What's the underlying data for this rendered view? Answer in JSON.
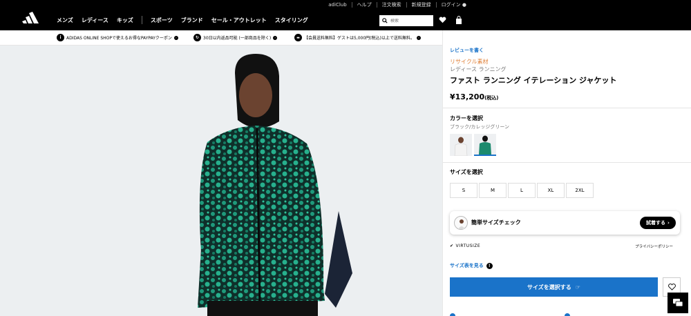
{
  "topbar": {
    "links": [
      "adiClub",
      "ヘルプ",
      "注文検索",
      "新規登録",
      "ログイン"
    ]
  },
  "nav": {
    "items": [
      "メンズ",
      "レディース",
      "キッズ",
      "スポーツ",
      "ブランド",
      "セール・アウトレット",
      "スタイリング"
    ],
    "search_placeholder": "検索",
    "icons": [
      "adidas-logo",
      "search-icon",
      "heart-icon",
      "bag-icon",
      "user-icon"
    ]
  },
  "promo": {
    "items": [
      {
        "icon": "i",
        "text": "ADIDAS ONLINE SHOPで使えるお得なPAYPAYクーポン"
      },
      {
        "icon": "↻",
        "text": "30日以内返品可能 (一部商品を除く)"
      },
      {
        "icon": "🚚",
        "text": "【会員送料無料】ゲストは5,000円(税込)以上で送料無料。"
      }
    ]
  },
  "product": {
    "review_link": "レビューを書く",
    "tag": "リサイクル素材",
    "category": "レディース ランニング",
    "title": "ファスト ランニング イテレーション ジャケット",
    "price": "¥13,200",
    "price_note": "(税込)",
    "color_label": "カラーを選択",
    "color_name": "ブラック/カレッジグリーン",
    "size_label": "サイズを選択",
    "sizes": [
      "S",
      "M",
      "L",
      "XL",
      "2XL"
    ],
    "fit_check": "簡単サイズチェック",
    "fit_button": "試着する",
    "virtualsize": "VIRTUSIZE",
    "privacy": "プライバシーポリシー",
    "size_chart": "サイズ表を見る",
    "cta": "サイズを選択する"
  },
  "colors": {
    "accent": "#1a73c9",
    "recycle": "#e0823a",
    "jacket": "#1c8a6e"
  }
}
